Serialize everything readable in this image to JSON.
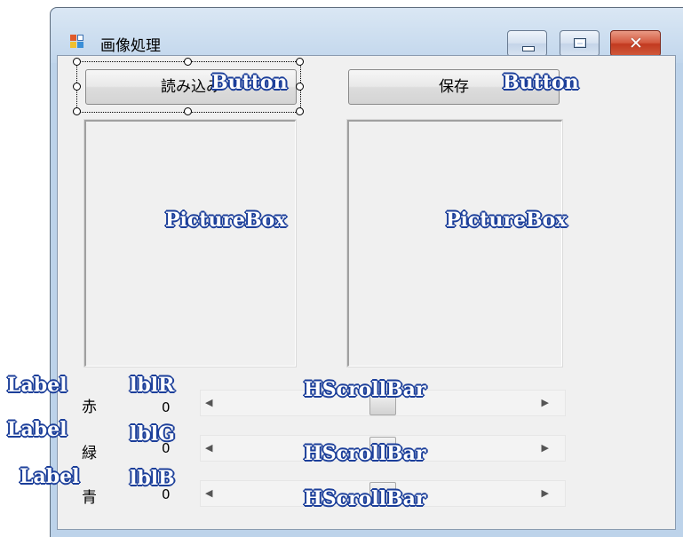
{
  "window": {
    "title": "画像処理",
    "controls": {
      "minimize": "minimize",
      "maximize": "maximize",
      "close": "✕"
    }
  },
  "buttons": {
    "load_label": "読み込み",
    "save_label": "保存"
  },
  "color_labels": {
    "red": "赤",
    "green": "緑",
    "blue": "青"
  },
  "values": {
    "lblR": "0",
    "lblG": "0",
    "lblB": "0"
  },
  "scrollbars": {
    "red_position": 0.5,
    "green_position": 0.5,
    "blue_position": 0.5,
    "arrow_left": "◀",
    "arrow_right": "▶"
  },
  "annotations": {
    "button_1": "Button",
    "button_2": "Button",
    "picturebox_1": "PictureBox",
    "picturebox_2": "PictureBox",
    "label_1": "Label",
    "label_2": "Label",
    "label_3": "Label",
    "lblR": "lblR",
    "lblG": "lblG",
    "lblB": "lblB",
    "hscroll_1": "HScrollBar",
    "hscroll_2": "HScrollBar",
    "hscroll_3": "HScrollBar"
  },
  "colors": {
    "annotation_text": "#ffffff",
    "annotation_outline": "#1c3f9a",
    "close_button": "#c23a20"
  },
  "icons": {
    "app": "app-icon",
    "minimize": "minimize-icon",
    "maximize": "maximize-icon",
    "close": "close-icon"
  }
}
